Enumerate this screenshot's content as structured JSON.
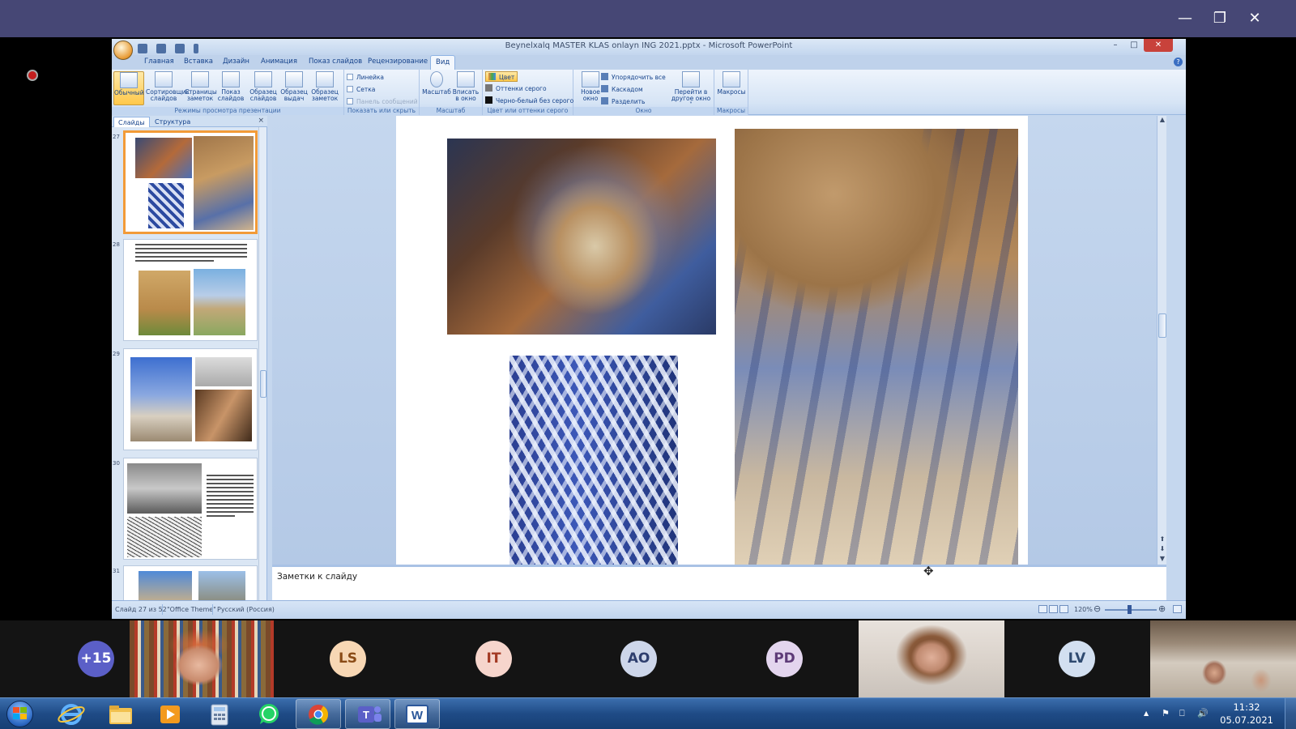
{
  "window": {
    "title": "Beynelxalq MASTER KLAS onlayn ING 2021.pptx - Microsoft PowerPoint",
    "minimize_glyph": "–",
    "maximize_glyph": "□",
    "close_glyph": "✕",
    "doc_close_glyph": "✕"
  },
  "host_window": {
    "minimize_glyph": "—",
    "restore_glyph": "❐",
    "close_glyph": "✕"
  },
  "ribbon": {
    "tabs": [
      "Главная",
      "Вставка",
      "Дизайн",
      "Анимация",
      "Показ слайдов",
      "Рецензирование",
      "Вид"
    ],
    "active_tab": "Вид",
    "help_glyph": "?",
    "groups": {
      "views": {
        "label": "Режимы просмотра презентации",
        "buttons": [
          {
            "l1": "Обычный",
            "l2": ""
          },
          {
            "l1": "Сортировщик",
            "l2": "слайдов"
          },
          {
            "l1": "Страницы",
            "l2": "заметок"
          },
          {
            "l1": "Показ",
            "l2": "слайдов"
          },
          {
            "l1": "Образец",
            "l2": "слайдов"
          },
          {
            "l1": "Образец",
            "l2": "выдач"
          },
          {
            "l1": "Образец",
            "l2": "заметок"
          }
        ]
      },
      "show": {
        "label": "Показать или скрыть",
        "items": [
          "Линейка",
          "Сетка",
          "Панель сообщений"
        ]
      },
      "zoom": {
        "label": "Масштаб",
        "buttons": [
          {
            "l1": "Масштаб",
            "l2": ""
          },
          {
            "l1": "Вписать",
            "l2": "в окно"
          }
        ]
      },
      "color": {
        "label": "Цвет или оттенки серого",
        "items": [
          "Цвет",
          "Оттенки серого",
          "Черно-белый без серого"
        ]
      },
      "window": {
        "label": "Окно",
        "new_window": {
          "l1": "Новое",
          "l2": "окно"
        },
        "items": [
          "Упорядочить все",
          "Каскадом",
          "Разделить"
        ],
        "switch": {
          "l1": "Перейти в",
          "l2": "другое окно ˅"
        }
      },
      "macros": {
        "label": "Макросы",
        "button": "Макросы"
      }
    }
  },
  "slides_panel": {
    "tabs": [
      "Слайды",
      "Структура"
    ],
    "close_glyph": "×",
    "numbers": [
      "27",
      "28",
      "29",
      "30",
      "31"
    ]
  },
  "notes": {
    "placeholder": "Заметки к слайду"
  },
  "scroll": {
    "up": "▲",
    "down": "▼",
    "prev": "⬆",
    "next": "⬇"
  },
  "status_bar": {
    "slide": "Слайд 27 из 52",
    "theme": "\"Office Theme\"",
    "language": "Русский (Россия)",
    "zoom": "120%",
    "zoom_minus": "⊖",
    "zoom_plus": "⊕"
  },
  "participants": [
    {
      "type": "overflow",
      "label": "+15",
      "bg": "#5b5fc7",
      "fg": "#ffffff"
    },
    {
      "type": "video",
      "name": "presenter-video"
    },
    {
      "type": "initials",
      "label": "LS",
      "bg": "#f7d7b4",
      "fg": "#8a4b16"
    },
    {
      "type": "initials",
      "label": "IT",
      "bg": "#f6d5cc",
      "fg": "#a33a24"
    },
    {
      "type": "initials",
      "label": "AO",
      "bg": "#cdd6ea",
      "fg": "#2e3e6e"
    },
    {
      "type": "initials",
      "label": "PD",
      "bg": "#e3d5ee",
      "fg": "#5e3b78"
    },
    {
      "type": "video",
      "name": "participant-video"
    },
    {
      "type": "initials",
      "label": "LV",
      "bg": "#d2dff0",
      "fg": "#2f4a70"
    },
    {
      "type": "video",
      "name": "participant-video-2"
    }
  ],
  "taskbar": {
    "clock_time": "11:32",
    "clock_date": "05.07.2021",
    "tray": [
      "▲",
      "⚑",
      "⎕",
      "🔊"
    ],
    "apps": [
      "internet-explorer-icon",
      "file-explorer-icon",
      "media-player-icon",
      "calculator-icon",
      "whatsapp-icon",
      "chrome-icon",
      "teams-icon",
      "word-icon"
    ]
  },
  "colors": {
    "teams_bar": "#464775",
    "ribbon_text": "#15428b",
    "selection_orange": "#f29b38",
    "taskbar": "#1f4b86"
  }
}
